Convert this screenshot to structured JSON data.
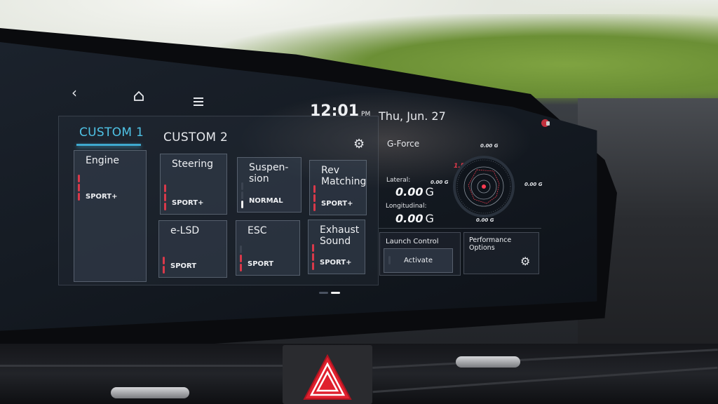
{
  "nav": {
    "back_icon": "chevron-left-icon",
    "home_icon": "home-icon",
    "menu_icon": "hamburger-menu-icon"
  },
  "status_bar": {
    "time": "12:01",
    "ampm": "PM",
    "date": "Thu, Jun. 27",
    "tray_icon": "notification-icon"
  },
  "tabs": [
    {
      "label": "CUSTOM 1",
      "active": true
    },
    {
      "label": "CUSTOM 2",
      "active": false
    }
  ],
  "settings_icon": "gear-icon",
  "drive_tiles": [
    {
      "title": "Engine",
      "mode": "SPORT+",
      "level": 3
    },
    {
      "title": "Steering",
      "mode": "SPORT+",
      "level": 3
    },
    {
      "title": "Suspen-\nsion",
      "mode": "NORMAL",
      "level": 1
    },
    {
      "title": "Rev\nMatching",
      "mode": "SPORT+",
      "level": 3
    },
    {
      "title": "e-LSD",
      "mode": "SPORT",
      "level": 2
    },
    {
      "title": "ESC",
      "mode": "SPORT",
      "level": 2
    },
    {
      "title": "Exhaust\nSound",
      "mode": "SPORT+",
      "level": 3
    }
  ],
  "pager": {
    "pages": 2,
    "current": 2
  },
  "g_force": {
    "title": "G-Force",
    "top": "0.00",
    "left": "0.00",
    "right": "0.00",
    "bottom": "0.00",
    "max": "1.5",
    "unit": "G",
    "lateral_label": "Lateral:",
    "lateral_value": "0.00",
    "longitudinal_label": "Longitudinal:",
    "longitudinal_value": "0.00"
  },
  "launch_control": {
    "label": "Launch Control",
    "button": "Activate"
  },
  "performance_options": {
    "label": "Performance Options",
    "icon": "gear-icon"
  },
  "colors": {
    "accent": "#4fc3e6",
    "active_bar": "#d9394a",
    "inactive_bar": "#3b4350"
  }
}
